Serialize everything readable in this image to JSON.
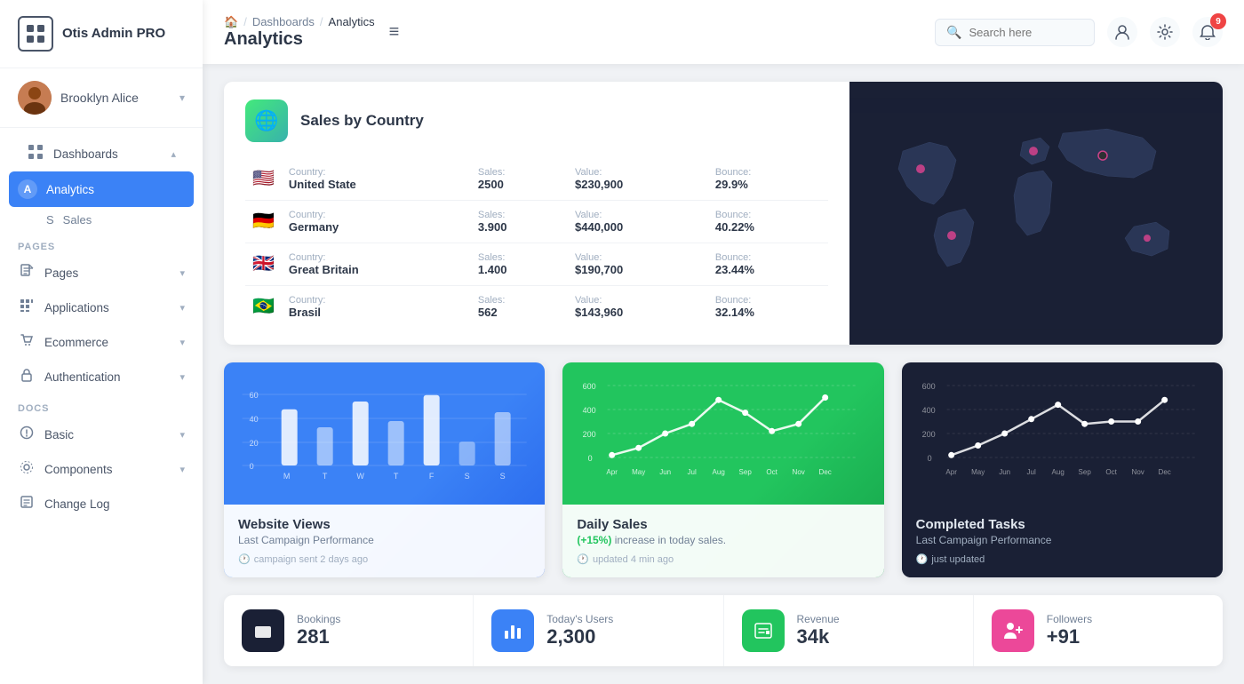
{
  "app": {
    "logo_text": "Otis Admin PRO",
    "logo_icon": "⊞"
  },
  "sidebar": {
    "user": {
      "name": "Brooklyn Alice",
      "chevron": "▾"
    },
    "sections": [
      {
        "label": "",
        "items": [
          {
            "id": "dashboards",
            "icon": "⊞",
            "label": "Dashboards",
            "chevron": "▴",
            "active_parent": true
          },
          {
            "id": "analytics",
            "letter": "A",
            "label": "Analytics",
            "active": true
          },
          {
            "id": "sales",
            "letter": "S",
            "label": "Sales",
            "active": false
          }
        ]
      },
      {
        "label": "PAGES",
        "items": [
          {
            "id": "pages",
            "icon": "🖼",
            "label": "Pages",
            "chevron": "▾"
          },
          {
            "id": "applications",
            "icon": "⋮⋮",
            "label": "Applications",
            "chevron": "▾"
          },
          {
            "id": "ecommerce",
            "icon": "🛍",
            "label": "Ecommerce",
            "chevron": "▾"
          },
          {
            "id": "authentication",
            "icon": "📋",
            "label": "Authentication",
            "chevron": "▾"
          }
        ]
      },
      {
        "label": "DOCS",
        "items": [
          {
            "id": "basic",
            "icon": "📘",
            "label": "Basic",
            "chevron": "▾"
          },
          {
            "id": "components",
            "icon": "⚙",
            "label": "Components",
            "chevron": "▾"
          },
          {
            "id": "changelog",
            "icon": "📰",
            "label": "Change Log"
          }
        ]
      }
    ]
  },
  "topbar": {
    "breadcrumb": {
      "home": "🏠",
      "items": [
        "Dashboards",
        "Analytics"
      ]
    },
    "page_title": "Analytics",
    "hamburger": "≡",
    "search": {
      "placeholder": "Search here",
      "value": ""
    },
    "notification_count": "9"
  },
  "sales_by_country": {
    "title": "Sales by Country",
    "icon": "🌐",
    "countries": [
      {
        "flag": "🇺🇸",
        "country_label": "Country:",
        "country": "United State",
        "sales_label": "Sales:",
        "sales": "2500",
        "value_label": "Value:",
        "value": "$230,900",
        "bounce_label": "Bounce:",
        "bounce": "29.9%"
      },
      {
        "flag": "🇩🇪",
        "country_label": "Country:",
        "country": "Germany",
        "sales_label": "Sales:",
        "sales": "3.900",
        "value_label": "Value:",
        "value": "$440,000",
        "bounce_label": "Bounce:",
        "bounce": "40.22%"
      },
      {
        "flag": "🇬🇧",
        "country_label": "Country:",
        "country": "Great Britain",
        "sales_label": "Sales:",
        "sales": "1.400",
        "value_label": "Value:",
        "value": "$190,700",
        "bounce_label": "Bounce:",
        "bounce": "23.44%"
      },
      {
        "flag": "🇧🇷",
        "country_label": "Country:",
        "country": "Brasil",
        "sales_label": "Sales:",
        "sales": "562",
        "value_label": "Value:",
        "value": "$143,960",
        "bounce_label": "Bounce:",
        "bounce": "32.14%"
      }
    ]
  },
  "website_views": {
    "title": "Website Views",
    "subtitle": "Last Campaign Performance",
    "footer": "campaign sent 2 days ago",
    "labels": [
      "M",
      "T",
      "W",
      "T",
      "F",
      "S",
      "S"
    ],
    "values": [
      42,
      30,
      48,
      35,
      58,
      20,
      45
    ],
    "y_max": 60
  },
  "daily_sales": {
    "title": "Daily Sales",
    "badge": "(+15%)",
    "subtitle": "increase in today sales.",
    "footer": "updated 4 min ago",
    "labels": [
      "Apr",
      "May",
      "Jun",
      "Jul",
      "Aug",
      "Sep",
      "Oct",
      "Nov",
      "Dec"
    ],
    "values": [
      20,
      80,
      200,
      280,
      480,
      380,
      220,
      280,
      500
    ],
    "y_max": 600
  },
  "completed_tasks": {
    "title": "Completed Tasks",
    "subtitle": "Last Campaign Performance",
    "footer": "just updated",
    "labels": [
      "Apr",
      "May",
      "Jun",
      "Jul",
      "Aug",
      "Sep",
      "Oct",
      "Nov",
      "Dec"
    ],
    "values": [
      20,
      100,
      200,
      320,
      440,
      280,
      300,
      300,
      480
    ],
    "y_max": 600
  },
  "stats": [
    {
      "id": "bookings",
      "icon": "🛋",
      "icon_style": "dark",
      "label": "Bookings",
      "value": "281"
    },
    {
      "id": "users",
      "icon": "📊",
      "icon_style": "blue",
      "label": "Today's Users",
      "value": "2,300"
    },
    {
      "id": "revenue",
      "icon": "🏪",
      "icon_style": "green",
      "label": "Revenue",
      "value": "34k"
    },
    {
      "id": "followers",
      "icon": "👤",
      "icon_style": "pink",
      "label": "Followers",
      "value": "+91"
    }
  ]
}
